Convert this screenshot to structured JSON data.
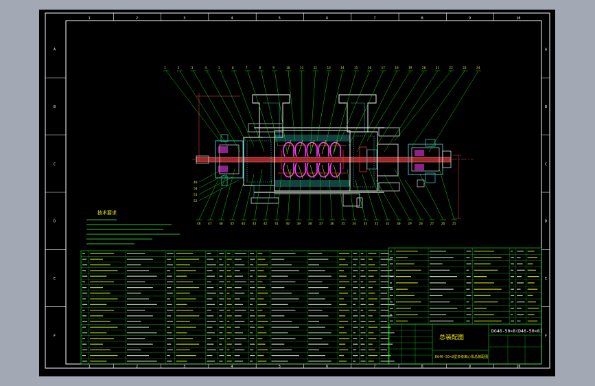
{
  "colors": {
    "background_outer": "#a2a8b4",
    "sheet": "#000000",
    "frame": "#ffffff",
    "table_lines": "#00e000",
    "leaders": "#00e000",
    "text_yellow": "#e8e800",
    "text_white": "#ffffff",
    "pump_body": "#e0e0e0",
    "impeller": "#ff40ff",
    "section_red": "#ff3030",
    "shaft": "#c03030",
    "hatch_cyan": "#30c0c0",
    "dim_blue": "#4080ff"
  },
  "zone_columns": [
    "1",
    "2",
    "3",
    "4",
    "5",
    "6",
    "7",
    "8",
    "9",
    "10"
  ],
  "zone_rows": [
    "A",
    "B",
    "C",
    "D",
    "E",
    "F"
  ],
  "title_block": {
    "drawing_number": "DG46-50×8(D46-50×8)",
    "name_block": "总装配图",
    "subtitle": "DG46-50×8型多级离心泵总装配图"
  },
  "technical_requirements": {
    "heading": "技术要求"
  },
  "callouts_top": [
    "1",
    "2",
    "3",
    "4",
    "5",
    "6",
    "7",
    "8",
    "9",
    "10",
    "11",
    "12",
    "13",
    "14",
    "15",
    "16",
    "17",
    "18",
    "19",
    "20",
    "21",
    "22",
    "23",
    "24"
  ],
  "callouts_bottom": [
    "48",
    "47",
    "46",
    "45",
    "44",
    "43",
    "42",
    "41",
    "40",
    "39",
    "38",
    "37",
    "36",
    "35",
    "34",
    "33",
    "32",
    "31",
    "30",
    "29",
    "28",
    "27",
    "26",
    "25"
  ],
  "callouts_left": [
    "49",
    "50",
    "51",
    "52"
  ],
  "bom_note": "bill-of-materials table text is too small to read at this resolution"
}
